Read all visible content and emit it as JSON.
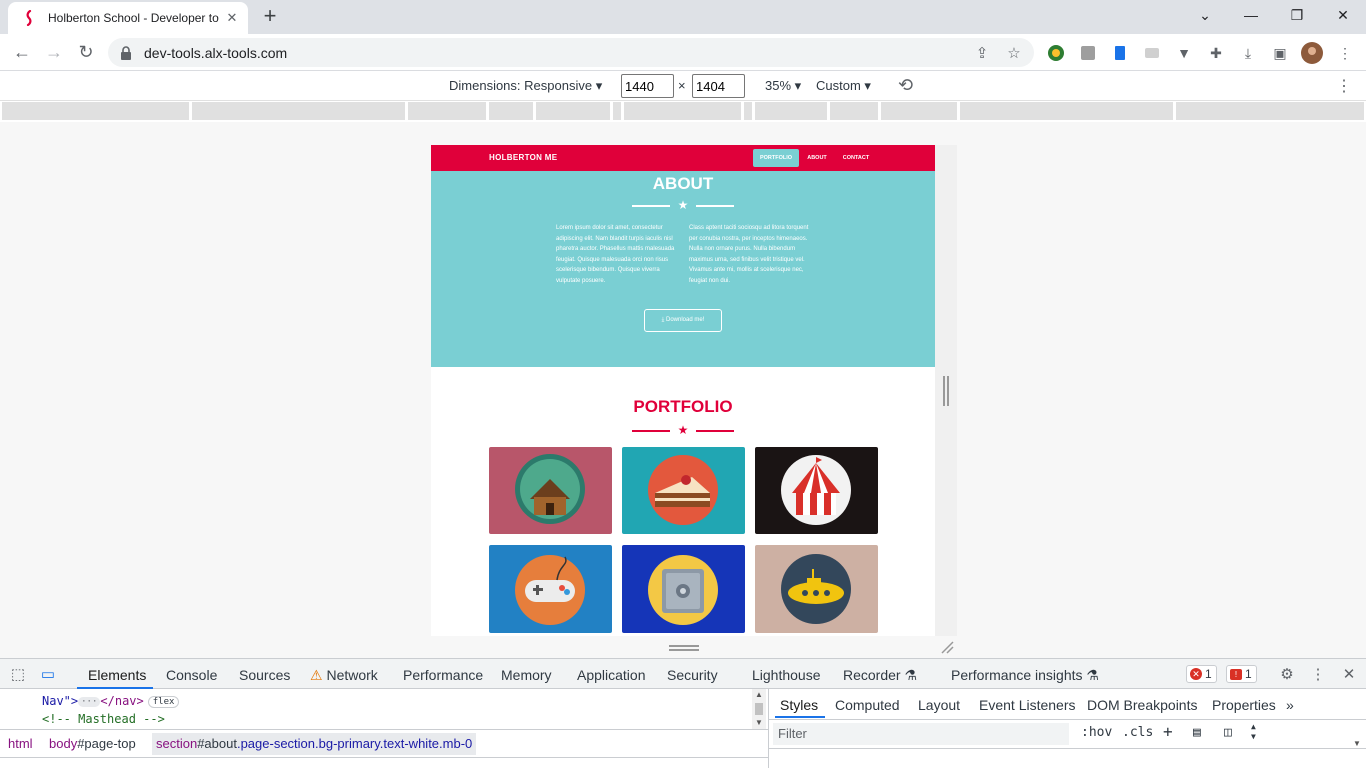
{
  "browser": {
    "tab_title": "Holberton School - Developer to",
    "url": "dev-tools.alx-tools.com"
  },
  "device_toolbar": {
    "dimensions_label": "Dimensions: Responsive",
    "width": "1440",
    "height": "1404",
    "times": "×",
    "zoom": "35%",
    "throttle": "Custom"
  },
  "site": {
    "brand": "HOLBERTON ME",
    "nav": [
      "PORTFOLIO",
      "ABOUT",
      "CONTACT"
    ],
    "about_title": "ABOUT",
    "about_left": "Lorem ipsum dolor sit amet, consectetur adipiscing elit. Nam blandit turpis iaculis nisl pharetra auctor. Phasellus mattis malesuada feugiat. Quisque malesuada orci non risus scelerisque bibendum. Quisque viverra vulputate posuere.",
    "about_right": "Class aptent taciti sociosqu ad litora torquent per conubia nostra, per inceptos himenaeos. Nulla non ornare purus. Nulla bibendum maximus urna, sed finibus velit tristique vel. Vivamus ante mi, mollis at scelerisque nec, feugiat non dui.",
    "download_label": "Download me!",
    "portfolio_title": "PORTFOLIO",
    "tiles": [
      {
        "name": "cabin",
        "bg": "#b8566a"
      },
      {
        "name": "cake",
        "bg": "#21a6b3"
      },
      {
        "name": "circus-tent",
        "bg": "#1a1414"
      },
      {
        "name": "game-controller",
        "bg": "#2281c4"
      },
      {
        "name": "safe",
        "bg": "#1535b8"
      },
      {
        "name": "submarine",
        "bg": "#cdb0a3"
      }
    ],
    "colors": {
      "primary": "#e0003a",
      "secondary": "#7acfd3"
    }
  },
  "devtools": {
    "tabs": [
      "Elements",
      "Console",
      "Sources",
      "Network",
      "Performance",
      "Memory",
      "Application",
      "Security",
      "Lighthouse",
      "Recorder",
      "Performance insights"
    ],
    "errors": "1",
    "issues": "1",
    "code": {
      "line1_attr": "Nav\">",
      "line1_close": "</nav>",
      "line1_badge": "flex",
      "line2": "<!-- Masthead -->"
    },
    "breadcrumbs": [
      {
        "tag": "html",
        "id": "",
        "cls": ""
      },
      {
        "tag": "body",
        "id": "#page-top",
        "cls": ""
      },
      {
        "tag": "section",
        "id": "#about",
        "cls": ".page-section.bg-primary.text-white.mb-0"
      }
    ],
    "styles_tabs": [
      "Styles",
      "Computed",
      "Layout",
      "Event Listeners",
      "DOM Breakpoints",
      "Properties"
    ],
    "filter_placeholder": "Filter",
    "hov": ":hov",
    "cls": ".cls"
  }
}
